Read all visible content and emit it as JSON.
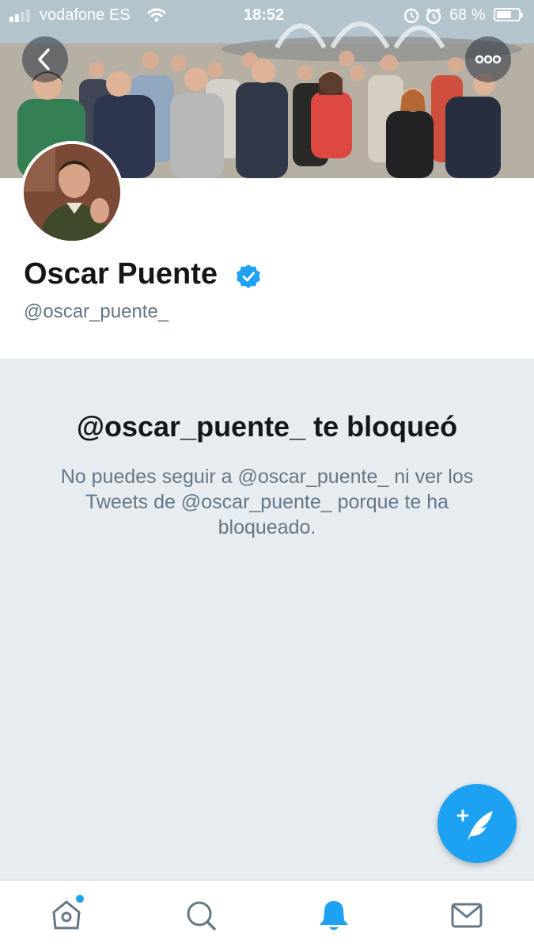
{
  "status_bar": {
    "carrier": "vodafone ES",
    "time": "18:52",
    "battery_percent": "68 %",
    "battery_level": 0.68,
    "signal_bars": 2
  },
  "profile": {
    "display_name": "Oscar Puente",
    "handle": "@oscar_puente_",
    "verified": true
  },
  "blocked": {
    "title": "@oscar_puente_ te bloqueó",
    "description": "No puedes seguir a @oscar_puente_ ni ver los Tweets de @oscar_puente_ porque te ha bloqueado."
  },
  "tabbar": {
    "items": [
      {
        "icon": "home-icon",
        "active": false,
        "badge": true
      },
      {
        "icon": "search-icon",
        "active": false,
        "badge": false
      },
      {
        "icon": "bell-icon",
        "active": true,
        "badge": false
      },
      {
        "icon": "mail-icon",
        "active": false,
        "badge": false
      }
    ]
  },
  "colors": {
    "accent": "#1da1f2",
    "background": "#e6ecf0",
    "text_primary": "#14171a",
    "text_secondary": "#657786"
  }
}
